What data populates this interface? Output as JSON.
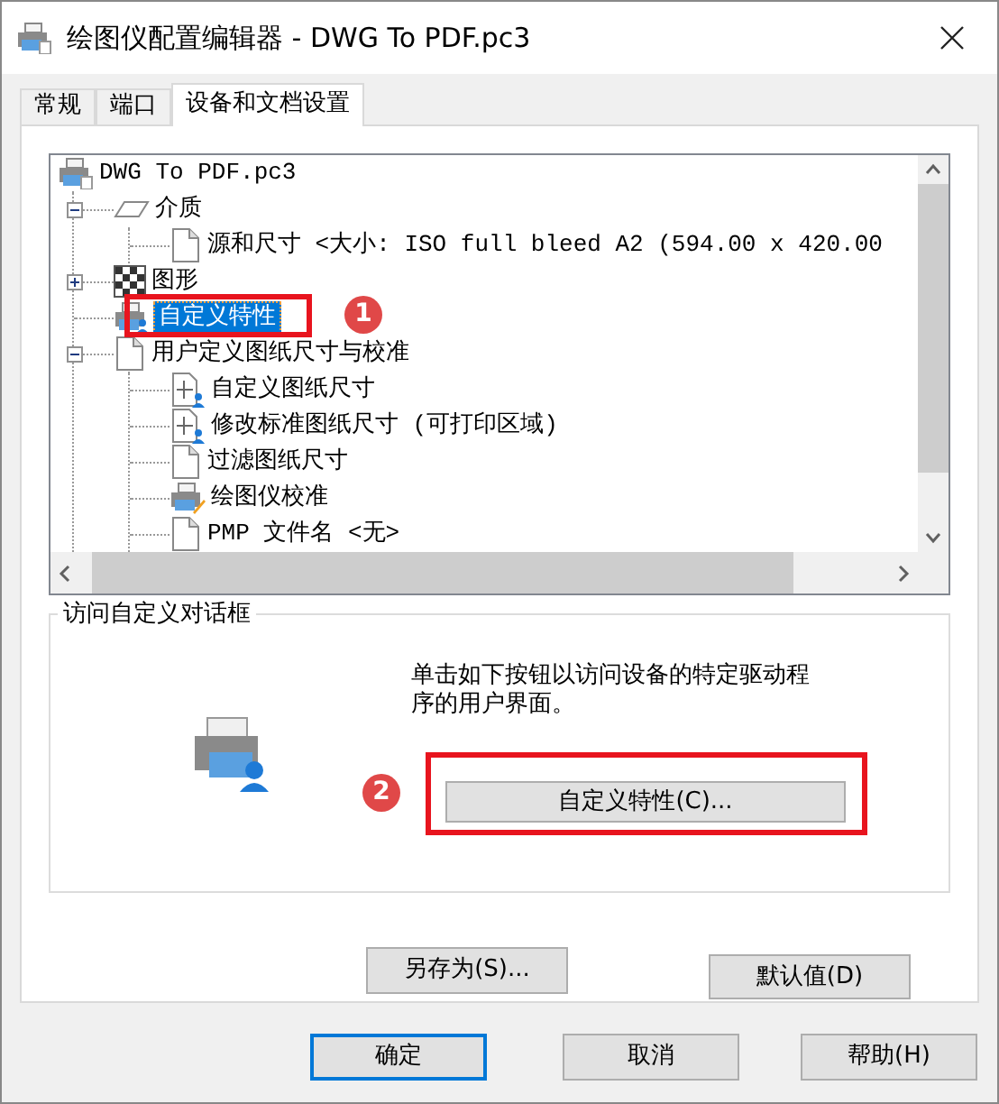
{
  "window": {
    "title": "绘图仪配置编辑器 - DWG To PDF.pc3"
  },
  "tabs": [
    {
      "label": "常规",
      "selected": false
    },
    {
      "label": "端口",
      "selected": false
    },
    {
      "label": "设备和文档设置",
      "selected": true
    }
  ],
  "tree": [
    {
      "label": "DWG To PDF.pc3",
      "kind": "plotter",
      "selected": false,
      "children": [
        {
          "label": "介质",
          "kind": "media",
          "selected": false,
          "expanded": true,
          "children": [
            {
              "label": "源和尺寸 <大小: ISO full bleed A2 (594.00 x 420.00",
              "kind": "sheet",
              "selected": false
            }
          ]
        },
        {
          "label": "图形",
          "kind": "graphics",
          "selected": false,
          "expanded": false
        },
        {
          "label": "自定义特性",
          "kind": "custom",
          "selected": true
        },
        {
          "label": "用户定义图纸尺寸与校准",
          "kind": "sheet",
          "selected": false,
          "expanded": true,
          "children": [
            {
              "label": "自定义图纸尺寸",
              "kind": "resize",
              "selected": false
            },
            {
              "label": "修改标准图纸尺寸 (可打印区域)",
              "kind": "resize",
              "selected": false
            },
            {
              "label": "过滤图纸尺寸",
              "kind": "sheet",
              "selected": false
            },
            {
              "label": "绘图仪校准",
              "kind": "calibrate",
              "selected": false
            },
            {
              "label": "PMP 文件名 <无>",
              "kind": "sheet",
              "selected": false
            }
          ]
        }
      ]
    }
  ],
  "group": {
    "title": "访问自定义对话框",
    "description": "单击如下按钮以访问设备的特定驱动程序的用户界面。",
    "button": "自定义特性(C)..."
  },
  "tab_buttons": [
    "另存为(S)...",
    "默认值(D)"
  ],
  "buttons": [
    {
      "label": "确定",
      "default": true
    },
    {
      "label": "取消",
      "default": false
    },
    {
      "label": "帮助(H)",
      "default": false
    }
  ],
  "callouts": [
    {
      "label": "1"
    },
    {
      "label": "2"
    }
  ]
}
